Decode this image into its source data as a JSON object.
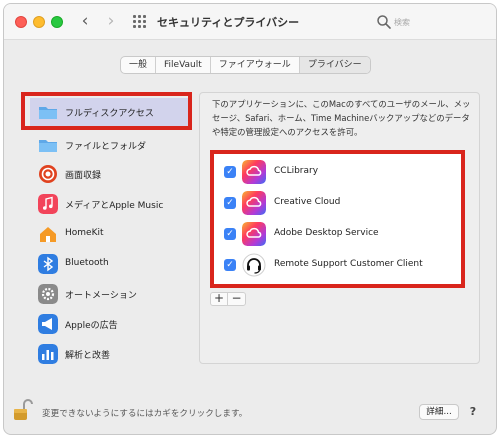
{
  "window": {
    "title": "セキュリティとプライバシー",
    "search_placeholder": "検索"
  },
  "tabs": [
    {
      "label": "一般",
      "active": false
    },
    {
      "label": "FileVault",
      "active": false
    },
    {
      "label": "ファイアウォール",
      "active": false
    },
    {
      "label": "プライバシー",
      "active": true
    }
  ],
  "sidebar": {
    "items": [
      {
        "label": "フルディスクアクセス",
        "icon": "folder-icon",
        "selected": true
      },
      {
        "label": "ファイルとフォルダ",
        "icon": "folder-icon",
        "selected": false
      },
      {
        "label": "画面収録",
        "icon": "screen-record-icon",
        "selected": false
      },
      {
        "label": "メディアとApple Music",
        "icon": "music-icon",
        "selected": false
      },
      {
        "label": "HomeKit",
        "icon": "home-icon",
        "selected": false
      },
      {
        "label": "Bluetooth",
        "icon": "bluetooth-icon",
        "selected": false
      },
      {
        "label": "オートメーション",
        "icon": "gear-icon",
        "selected": false
      },
      {
        "label": "Appleの広告",
        "icon": "megaphone-icon",
        "selected": false
      },
      {
        "label": "解析と改善",
        "icon": "chart-icon",
        "selected": false
      }
    ]
  },
  "main": {
    "description": "下のアプリケーションに、このMacのすべてのユーザのメール、メッセージ、Safari、ホーム、Time Machineバックアップなどのデータや特定の管理設定へのアクセスを許可。",
    "apps": [
      {
        "name": "CCLibrary",
        "checked": true,
        "icon": "creative-cloud-icon"
      },
      {
        "name": "Creative Cloud",
        "checked": true,
        "icon": "creative-cloud-icon"
      },
      {
        "name": "Adobe Desktop Service",
        "checked": true,
        "icon": "creative-cloud-icon"
      },
      {
        "name": "Remote Support Customer Client",
        "checked": true,
        "icon": "headset-icon"
      }
    ],
    "add_label": "+",
    "remove_label": "−"
  },
  "footer": {
    "lock_text": "変更できないようにするにはカギをクリックします。",
    "details_label": "詳細...",
    "help_label": "?"
  },
  "colors": {
    "highlight_red": "#d9251c",
    "selection": "#d2d3ec",
    "checkbox_blue": "#3b82f6"
  }
}
